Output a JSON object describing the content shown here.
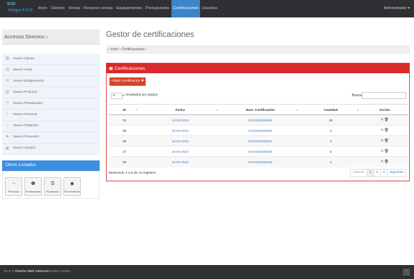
{
  "navbar": {
    "brand_logo": "IESE",
    "brand_text": "Intégra E.S.E",
    "items": [
      {
        "label": "Inicio"
      },
      {
        "label": "Clientes"
      },
      {
        "label": "Ventas"
      },
      {
        "label": "Resumen ventas"
      },
      {
        "label": "Equipamientos"
      },
      {
        "label": "Presupuestos"
      },
      {
        "label": "Certificaciones",
        "active": true
      },
      {
        "label": "Usuarios"
      }
    ],
    "user_menu": "Administrador ▾"
  },
  "sidebar": {
    "accesos_title": "Accesos Directos ›",
    "shortcuts": [
      {
        "label": "Nuevo Cliente",
        "icon": "▦"
      },
      {
        "label": "Nueva Venta",
        "icon": "▤"
      },
      {
        "label": "Nuevo Equipamiento",
        "icon": "≪"
      },
      {
        "label": "Nuevo Producto",
        "icon": "▥"
      },
      {
        "label": "Nuevo Presupuesto",
        "icon": "✎"
      },
      {
        "label": "Nuevo Personal",
        "icon": "+"
      },
      {
        "label": "Nueva Población",
        "icon": "⌂"
      },
      {
        "label": "Nuevo Proveedor",
        "icon": "⚑"
      },
      {
        "label": "Nuevo Usuario",
        "icon": "▣"
      }
    ],
    "otros_title": "Otros Listados",
    "otros": [
      {
        "label": "Personal",
        "icon": "→"
      },
      {
        "label": "Poblaciones",
        "icon": "❶"
      },
      {
        "label": "Productos",
        "icon": "☰"
      },
      {
        "label": "Proveedores",
        "icon": "◉"
      }
    ]
  },
  "main": {
    "title": "Gestor de certificaciones",
    "breadcrumb": {
      "home": "⌂ Inicio",
      "sep": "›",
      "current": "Certificaciones",
      "tail": "›"
    },
    "panel_title": "▣ Certificaciones",
    "add_button": "Añadir Certificación ✚",
    "length_value": "5",
    "length_caret": "▾",
    "length_label": "resultados por página",
    "search_label": "Buscar:",
    "search_value": "",
    "columns": [
      "ID",
      "Fecha",
      "Num. Certificación",
      "Cantidad",
      "Acción"
    ],
    "rows": [
      {
        "id": "32",
        "fecha": "14-04-2015",
        "num": "0103401562459",
        "cantidad": "15"
      },
      {
        "id": "35",
        "fecha": "24-04-2015",
        "num": "0103201568040",
        "cantidad": "4"
      },
      {
        "id": "36",
        "fecha": "24-04-2015",
        "num": "0103401568023",
        "cantidad": "2"
      },
      {
        "id": "37",
        "fecha": "24-04-2015",
        "num": "0103401568038",
        "cantidad": "5"
      },
      {
        "id": "38",
        "fecha": "24-04-2015",
        "num": "0103401568049",
        "cantidad": "2"
      }
    ],
    "action_edit_icon": "✎",
    "action_delete_icon": "🗑",
    "info": "Mostrando 1 a 5 de 14 registros",
    "pager": {
      "prev": "Anterior",
      "pages": [
        "1",
        "2",
        "3"
      ],
      "next": "Siguiente"
    }
  },
  "footer": {
    "prefix": "2015 ©",
    "brand": "Diseño Web Valencia",
    "suffix": "Busker Studio.",
    "top_icon": "⌃"
  }
}
